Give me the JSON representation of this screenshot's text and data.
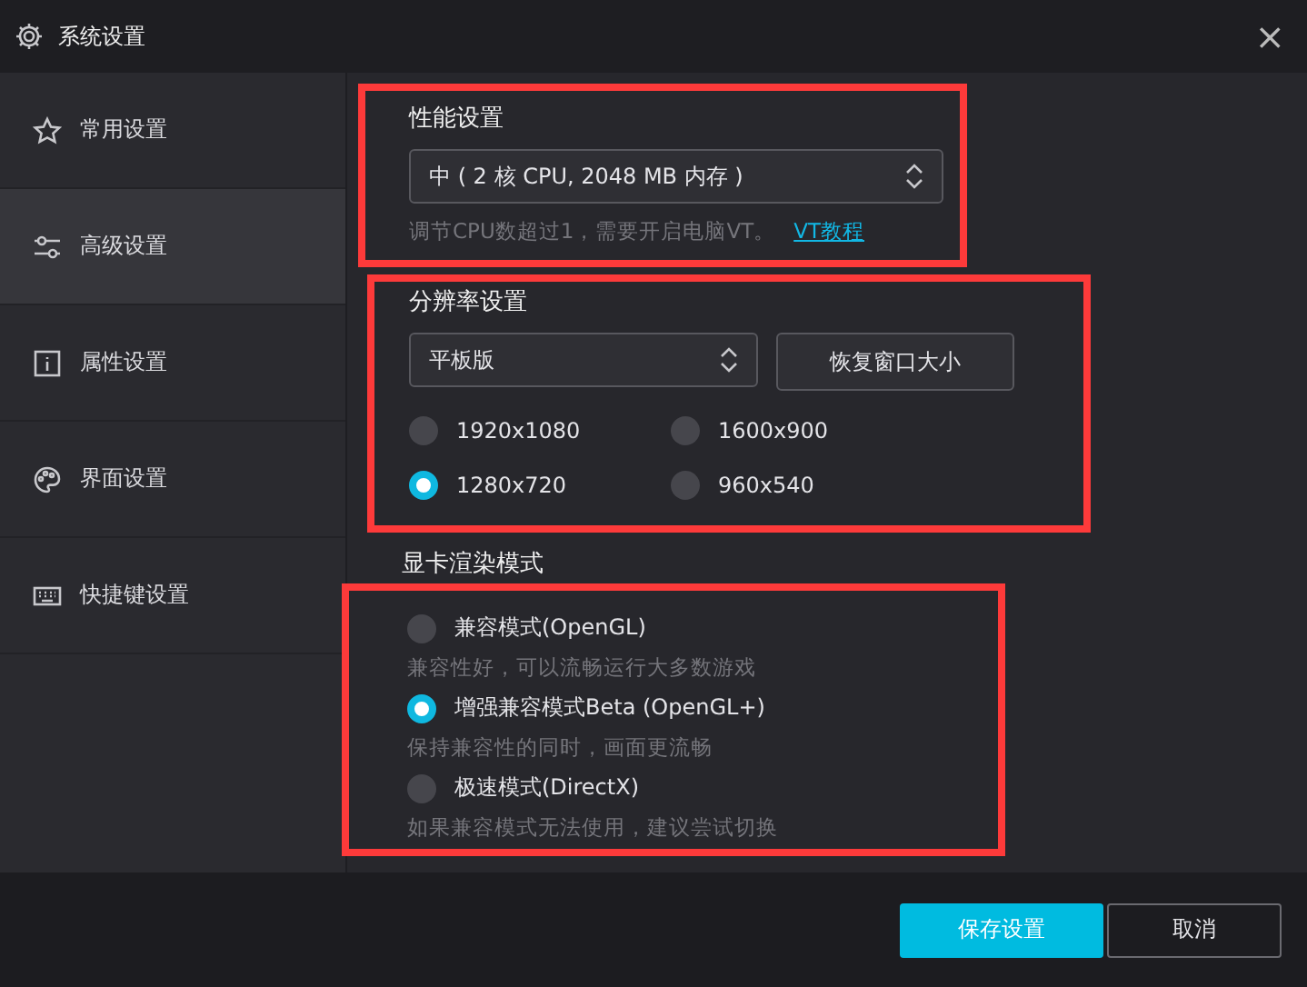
{
  "window": {
    "title": "系统设置",
    "close": "×"
  },
  "sidebar": {
    "items": [
      {
        "label": "常用设置",
        "kind": "star",
        "selected": false
      },
      {
        "label": "高级设置",
        "kind": "sliders",
        "selected": true
      },
      {
        "label": "属性设置",
        "kind": "info",
        "selected": false
      },
      {
        "label": "界面设置",
        "kind": "palette",
        "selected": false
      },
      {
        "label": "快捷键设置",
        "kind": "keyboard",
        "selected": false
      }
    ]
  },
  "performance": {
    "title": "性能设置",
    "highlighted": true,
    "select": "中 ( 2 核 CPU, 2048 MB 内存 )",
    "hint": "调节CPU数超过1，需要开启电脑VT。",
    "link": "VT教程"
  },
  "resolution": {
    "title": "分辨率设置",
    "highlighted": true,
    "select": "平板版",
    "button": "恢复窗口大小",
    "options": [
      {
        "label": "1920x1080",
        "selected": false
      },
      {
        "label": "1600x900",
        "selected": false
      },
      {
        "label": "1280x720",
        "selected": true
      },
      {
        "label": "960x540",
        "selected": false
      }
    ]
  },
  "render": {
    "title": "显卡渲染模式",
    "highlighted": true,
    "options": [
      {
        "label": "兼容模式(OpenGL)",
        "hint": "兼容性好，可以流畅运行大多数游戏",
        "selected": false
      },
      {
        "label": "增强兼容模式Beta (OpenGL+)",
        "hint": "保持兼容性的同时，画面更流畅",
        "selected": true
      },
      {
        "label": "极速模式(DirectX)",
        "hint": "如果兼容模式无法使用，建议尝试切换",
        "selected": false
      }
    ]
  },
  "buttons": [
    {
      "label": "保存设置",
      "kind": "primary"
    },
    {
      "label": "取消",
      "kind": "secondary"
    }
  ]
}
